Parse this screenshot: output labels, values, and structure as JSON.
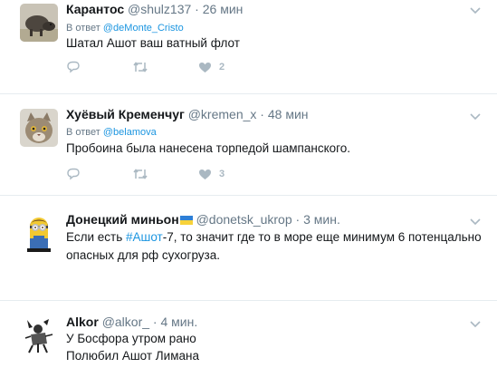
{
  "colors": {
    "link": "#1b95e0",
    "muted": "#657786",
    "icon": "#aab8c2",
    "divider": "#e6ecf0"
  },
  "tweets": [
    {
      "avatar_icon": "boar-avatar-icon",
      "display_name": "Карантос",
      "handle": "@shulz137",
      "dot": "·",
      "time": "26 мин",
      "reply_prefix": "В ответ",
      "reply_to": "@deMonte_Cristo",
      "text": "Шатал Ашот ваш ватный флот",
      "like_count": "2"
    },
    {
      "avatar_icon": "cat-avatar-icon",
      "display_name": "Хуёвый Кременчуг",
      "handle": "@kremen_x",
      "dot": "·",
      "time": "48 мин",
      "reply_prefix": "В ответ",
      "reply_to": "@belamova",
      "text": "Пробоина была нанесена торпедой шампанского.",
      "like_count": "3"
    },
    {
      "avatar_icon": "minion-avatar-icon",
      "display_name": "Донецкий миньон",
      "flag_icon": "ukraine-flag-icon",
      "handle": "@donetsk_ukrop",
      "dot": "·",
      "time": "3 мин.",
      "text_before_hashtag": "Если есть ",
      "hashtag": "#Ашот",
      "text_after_hashtag": "-7, то значит где то в море еще минимум 6 потенцально",
      "text_line_2": "опасных для рф сухогруза."
    },
    {
      "avatar_icon": "knight-sketch-avatar-icon",
      "display_name": "Alkor",
      "handle": "@alkor_",
      "dot": "·",
      "time": "4 мин.",
      "text_line_1": "У Босфора утром рано",
      "text_line_2": "Полюбил Ашот Лимана"
    }
  ]
}
